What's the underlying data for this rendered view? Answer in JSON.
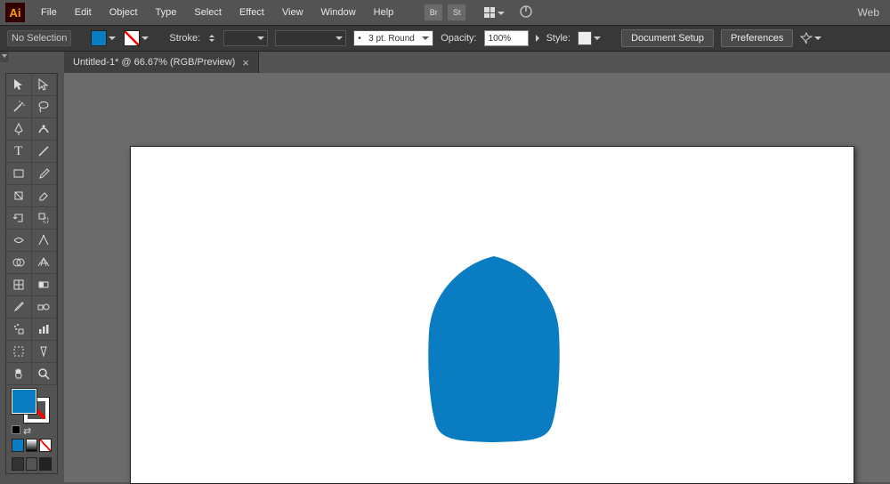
{
  "app": {
    "logo": "Ai"
  },
  "menu": [
    "File",
    "Edit",
    "Object",
    "Type",
    "Select",
    "Effect",
    "View",
    "Window",
    "Help"
  ],
  "workspace_label": "Web",
  "control": {
    "selection_status": "No Selection",
    "stroke_label": "Stroke:",
    "brush_label": "3 pt. Round",
    "opacity_label": "Opacity:",
    "opacity_value": "100%",
    "style_label": "Style:",
    "doc_setup_btn": "Document Setup",
    "preferences_btn": "Preferences"
  },
  "tab": {
    "title": "Untitled-1* @ 66.67% (RGB/Preview)",
    "close": "×"
  },
  "colors": {
    "fill": "#0a7dc2",
    "artboard_bg": "#ffffff",
    "work_bg": "#6b6b6b",
    "ui_bg": "#535353"
  },
  "tools": {
    "left_column": [
      "selection",
      "magic-wand",
      "pen",
      "type",
      "rectangle",
      "line-segment",
      "reflect",
      "width",
      "shape-builder",
      "mesh",
      "eyedropper",
      "symbol-sprayer",
      "artboard",
      "hand"
    ],
    "right_column": [
      "direct-selection",
      "lasso",
      "curvature",
      "line",
      "paintbrush",
      "eraser",
      "free-transform",
      "puppet-warp",
      "perspective-grid",
      "gradient",
      "blend",
      "column-graph",
      "slice",
      "zoom"
    ]
  }
}
